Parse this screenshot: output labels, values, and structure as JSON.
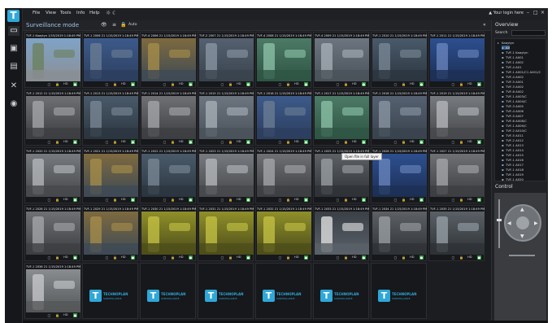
{
  "app": {
    "logo_letter": "T"
  },
  "menu": [
    "File",
    "View",
    "Tools",
    "Info",
    "Help"
  ],
  "menu_icons": {
    "theme": "☼",
    "night": "☾"
  },
  "user": "▲ Your login here",
  "window_controls": [
    "–",
    "□",
    "×"
  ],
  "mode_title": "Surveillance mode",
  "modebar": {
    "eye": "👁",
    "layout": "≡",
    "lock": "🔒",
    "zoom": "Auto",
    "collapse": "«"
  },
  "tooltip": "Open file in full layer",
  "cameras": [
    {
      "title": "TVF-1 Kaaytyn 1/15/2019 1:18:49 PM",
      "scene": "outdoor"
    },
    {
      "title": "TVF-1 2006 21 1/15/2019 1:18:49 PM",
      "scene": "worker"
    },
    {
      "title": "TVF-4 2006 21 1/15/2019 1:18:49 PM",
      "scene": "machine"
    },
    {
      "title": "TVF-2 2007 21 1/15/2019 1:18:49 PM",
      "scene": "hall"
    },
    {
      "title": "TVF-4 2008 21 1/15/2019 1:18:49 PM",
      "scene": "greenroom"
    },
    {
      "title": "TVF-4 2009 21 1/15/2019 1:18:49 PM",
      "scene": "corridor"
    },
    {
      "title": "TVF-1 2010 21 1/15/2019 1:18:49 PM",
      "scene": "pipes"
    },
    {
      "title": "TVF-1 2011 21 1/15/2019 1:18:49 PM",
      "scene": "blue"
    },
    {
      "title": "TVF-1 2012 21 1/15/2019 1:18:49 PM",
      "scene": "tank"
    },
    {
      "title": "TVF-1 2013 21 1/15/2019 1:18:49 PM",
      "scene": "pipes"
    },
    {
      "title": "TVF-1 2014 21 1/15/2019 1:18:49 PM",
      "scene": "tank"
    },
    {
      "title": "TVF-1 2015 21 1/15/2019 1:18:49 PM",
      "scene": "corridor"
    },
    {
      "title": "TVF-1 2016 21 1/15/2019 1:18:49 PM",
      "scene": "worker"
    },
    {
      "title": "TVF-1 2017 21 1/15/2019 1:18:49 PM",
      "scene": "greenroom"
    },
    {
      "title": "TVF-1 2018 21 1/15/2019 1:18:49 PM",
      "scene": "hall"
    },
    {
      "title": "TVF-1 2019 21 1/15/2019 1:18:49 PM",
      "scene": "pipe-h"
    },
    {
      "title": "TVF-1 2020 21 1/15/2019 1:18:49 PM",
      "scene": "pipe-h"
    },
    {
      "title": "TVF-1 2021 21 1/15/2019 1:18:49 PM",
      "scene": "machine"
    },
    {
      "title": "TVF-1 2022 21 1/15/2019 1:18:49 PM",
      "scene": "pipes"
    },
    {
      "title": "TVF-1 2023 21 1/15/2019 1:18:49 PM",
      "scene": "pipe-h"
    },
    {
      "title": "TVF-1 2024 21 1/15/2019 1:18:49 PM",
      "scene": "tank"
    },
    {
      "title": "TVF-1 2025 21 1/15/2019 1:18:49 PM",
      "scene": "panel"
    },
    {
      "title": "TVF-1 2026 21 1/15/2019 1:18:49 PM",
      "scene": "blue"
    },
    {
      "title": "TVF-1 2027 21 1/15/2019 1:18:49 PM",
      "scene": "tank"
    },
    {
      "title": "TVF-1 2028 21 1/15/2019 1:18:49 PM",
      "scene": "tank"
    },
    {
      "title": "TVF-1 2029 21 1/15/2019 1:18:49 PM",
      "scene": "machine"
    },
    {
      "title": "TVF-1 2030 21 1/15/2019 1:18:49 PM",
      "scene": "yellowroom"
    },
    {
      "title": "TVF-1 2031 21 1/15/2019 1:18:49 PM",
      "scene": "yellowroom"
    },
    {
      "title": "TVF-1 2032 21 1/15/2019 1:18:49 PM",
      "scene": "yellowroom"
    },
    {
      "title": "TVF-1 2033 21 1/15/2019 1:18:49 PM",
      "scene": "screen"
    },
    {
      "title": "TVF-1 2034 21 1/15/2019 1:18:49 PM",
      "scene": "panel"
    },
    {
      "title": "TVF-1 2035 21 1/15/2019 1:18:49 PM",
      "scene": "control"
    },
    {
      "title": "TVF-1 2036 21 1/15/2019 1:18:49 PM",
      "scene": "office"
    }
  ],
  "empty_slot": {
    "letter": "T",
    "line1": "TECHNOPLAN",
    "line2": "SURVEILLANCE"
  },
  "empty_slot_count": 6,
  "cam_hd_label": "HD",
  "cam_controls": {
    "snapshot": "▢",
    "lock": "🔒",
    "record": "●"
  },
  "overview": {
    "title": "Overview",
    "search_label": "Search",
    "search_value": "",
    "tree": [
      {
        "label": "Kaaytyn",
        "root": true
      },
      {
        "label": "All",
        "sel": true
      },
      {
        "label": "TVF-1 Kaaytyn"
      },
      {
        "label": "TVF-1 A001"
      },
      {
        "label": "TVF-1 A002"
      },
      {
        "label": "TVF-4 A01"
      },
      {
        "label": "TVF-1 A001/C1 A001/C"
      },
      {
        "label": "TVF-4 A002"
      },
      {
        "label": "TVF-5 A001"
      },
      {
        "label": "TVF-3 A002"
      },
      {
        "label": "TVF-6 A002"
      },
      {
        "label": "TVF-1 A003/C"
      },
      {
        "label": "TVF-1 A004/C"
      },
      {
        "label": "TVF-3 A005"
      },
      {
        "label": "TVF-4 A006"
      },
      {
        "label": "TVF-5 A007"
      },
      {
        "label": "TVF-6 A008/C"
      },
      {
        "label": "TVF-1 A009/C"
      },
      {
        "label": "TVF-2 A010/C"
      },
      {
        "label": "TVF-5 A011"
      },
      {
        "label": "TVF-2 A012"
      },
      {
        "label": "TVF-1 A013"
      },
      {
        "label": "TVF-1 A014"
      },
      {
        "label": "TVF-1 A015"
      },
      {
        "label": "TVF-1 A016"
      },
      {
        "label": "TVF-1 A017"
      },
      {
        "label": "TVF-1 A018"
      },
      {
        "label": "TVF-1 A019"
      },
      {
        "label": "TVF-1 A020"
      }
    ]
  },
  "control": {
    "title": "Control"
  },
  "rail": {
    "monitor": "▭",
    "display": "▣",
    "layers": "▤",
    "tools": "✕",
    "gamepad": "◉"
  },
  "colors": {
    "accent": "#2fa7d8",
    "record": "#2e9a3e",
    "background": "#1b1d20"
  }
}
